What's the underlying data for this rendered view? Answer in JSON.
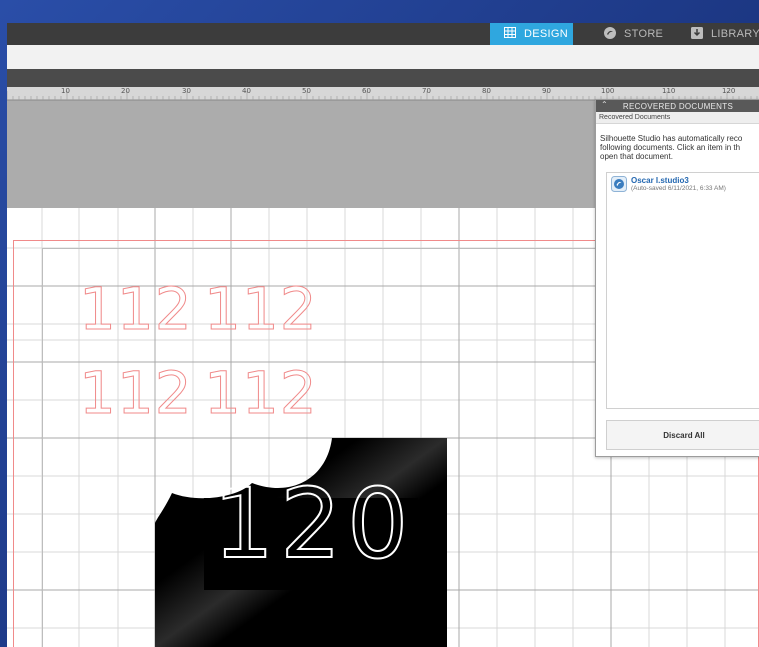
{
  "nav": {
    "tabs": [
      {
        "label": "DESIGN",
        "icon": "grid-icon",
        "active": true
      },
      {
        "label": "STORE",
        "icon": "silhouette-s-icon",
        "active": false
      },
      {
        "label": "LIBRARY",
        "icon": "library-download-icon",
        "active": false
      }
    ]
  },
  "ruler": {
    "labels": [
      "10",
      "20",
      "30",
      "40",
      "50",
      "60",
      "70",
      "80",
      "90",
      "100",
      "110",
      "120"
    ]
  },
  "canvas": {
    "stencil_text_outline": "112",
    "stencil_text_main": "120"
  },
  "recovered_panel": {
    "header": "RECOVERED DOCUMENTS",
    "subheader": "Recovered Documents",
    "message": "Silhouette Studio has automatically reco\nfollowing documents. Click an item in th\nopen that document.",
    "documents": [
      {
        "name": "Oscar I.studio3",
        "meta": "(Auto-saved 6/11/2021, 6:33 AM)"
      }
    ],
    "discard_label": "Discard All"
  },
  "colors": {
    "accent": "#2fa7df",
    "cut_line": "#f08a8a",
    "nav_bg": "#3c3c3c"
  }
}
